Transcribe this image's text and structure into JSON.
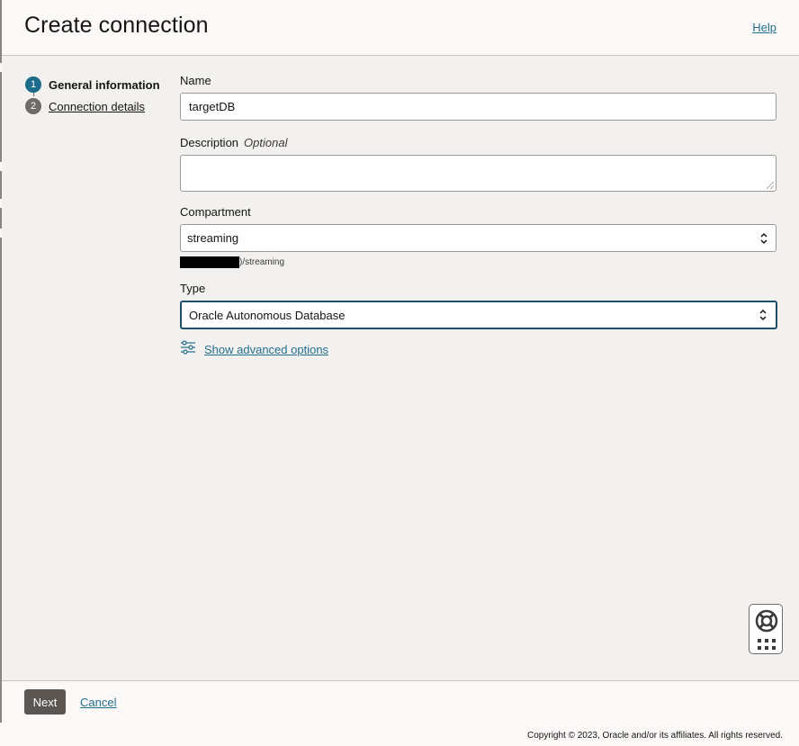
{
  "header": {
    "title": "Create connection",
    "help_label": "Help"
  },
  "steps": [
    {
      "number": "1",
      "label": "General information",
      "state": "active"
    },
    {
      "number": "2",
      "label": "Connection details",
      "state": "inactive"
    }
  ],
  "form": {
    "name": {
      "label": "Name",
      "value": "targetDB"
    },
    "description": {
      "label": "Description",
      "optional_label": "Optional",
      "value": ""
    },
    "compartment": {
      "label": "Compartment",
      "value": "streaming",
      "path_suffix": ")/streaming"
    },
    "type": {
      "label": "Type",
      "value": "Oracle Autonomous Database"
    },
    "advanced_options_label": "Show advanced options"
  },
  "footer": {
    "next_label": "Next",
    "cancel_label": "Cancel"
  },
  "copyright": "Copyright © 2023, Oracle and/or its affiliates. All rights reserved.",
  "colors": {
    "accent": "#1d6b8a",
    "link": "#246e8f",
    "primary_button": "#5b5652"
  },
  "icons": {
    "advanced_options": "sliders-icon",
    "help_widget": "life-ring-icon",
    "apps_grid": "grid-icon"
  }
}
